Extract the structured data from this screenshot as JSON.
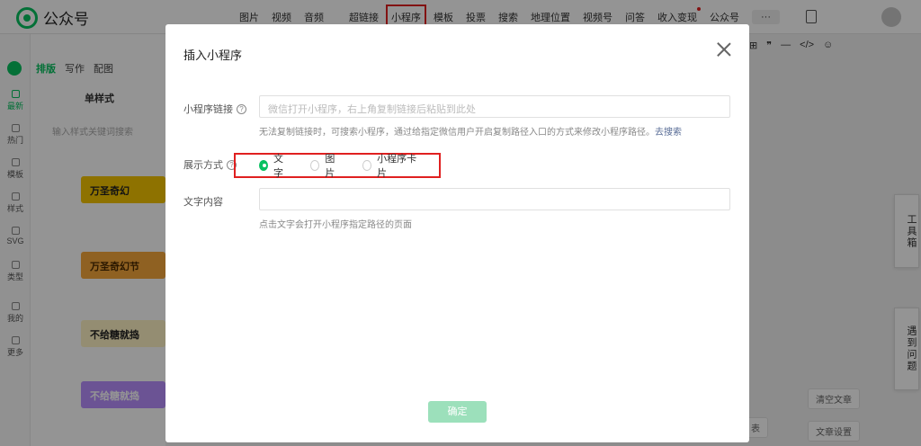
{
  "app": {
    "title": "公众号"
  },
  "topnav": {
    "items": [
      "图片",
      "视频",
      "音频",
      "超链接",
      "小程序",
      "模板",
      "投票",
      "搜索",
      "地理位置",
      "视频号",
      "问答",
      "收入变现",
      "公众号",
      "···"
    ],
    "active_index": 4
  },
  "rail": {
    "items": [
      "最新",
      "热门",
      "模板",
      "样式",
      "SVG",
      "类型",
      "我的",
      "更多"
    ]
  },
  "panel": {
    "tabs": [
      "排版",
      "写作",
      "配图"
    ],
    "subtitle": "单样式",
    "search_placeholder": "输入样式关键词搜索",
    "cards": [
      "万圣奇幻",
      "万圣奇幻节",
      "不给糖就捣",
      "不给糖就捣"
    ]
  },
  "editor_toolbar": [
    "⊞",
    "❞",
    "—",
    "</>",
    "☺"
  ],
  "side_tools": {
    "toolbox": "工具箱",
    "help": "遇到问题"
  },
  "bottom_right": {
    "clear": "清空文章",
    "settings": "文章设置",
    "partial": "表"
  },
  "dialog": {
    "title": "插入小程序",
    "link_label": "小程序链接",
    "link_placeholder": "微信打开小程序，右上角复制链接后粘贴到此处",
    "link_hint": "无法复制链接时，可搜索小程序，通过给指定微信用户开启复制路径入口的方式来修改小程序路径。",
    "link_hint_action": "去搜索",
    "display_label": "展示方式",
    "display_options": [
      "文字",
      "图片",
      "小程序卡片"
    ],
    "display_selected": 0,
    "text_label": "文字内容",
    "text_value": "",
    "text_hint": "点击文字会打开小程序指定路径的页面",
    "confirm": "确定"
  },
  "colors": {
    "accent": "#07c160",
    "highlight": "#e02020",
    "link": "#576b95"
  }
}
